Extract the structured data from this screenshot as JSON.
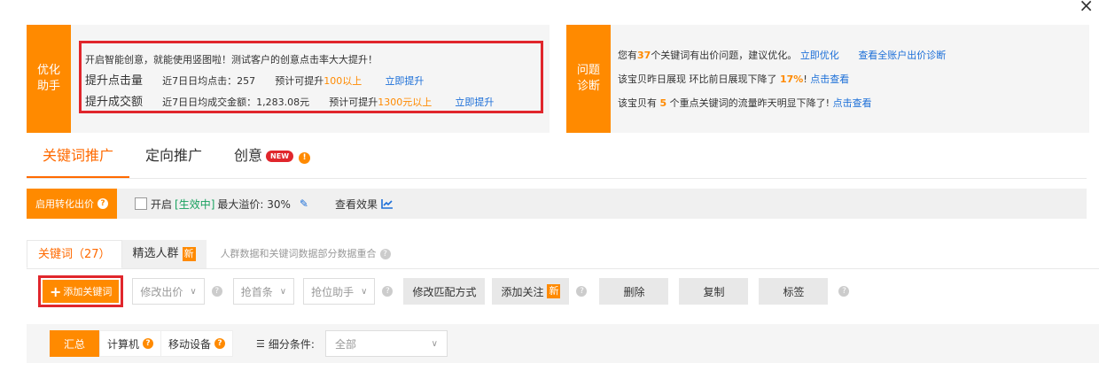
{
  "close": "×",
  "optimize": {
    "tag": "优化助手",
    "line1": "开启智能创意，就能使用竖图啦！测试客户的创意点击率大大提升！",
    "line2": {
      "title": "提升点击量",
      "stat_label": "近7日日均点击：257",
      "predict_prefix": "预计可提升",
      "predict_value": "100以上",
      "action": "立即提升"
    },
    "line3": {
      "title": "提升成交额",
      "stat_label": "近7日日均成交金额：1,283.08元",
      "predict_prefix": "预计可提升",
      "predict_value": "1300元以上",
      "action": "立即提升"
    }
  },
  "diagnosis": {
    "tag": "问题诊断",
    "line1": {
      "prefix": "您有",
      "count": "37",
      "suffix": "个关键词有出价问题，建议优化。",
      "link1": "立即优化",
      "link2": "查看全账户出价诊断"
    },
    "line2": {
      "text": "该宝贝昨日展现 环比前日展现下降了",
      "pct": "17%",
      "bang": "!",
      "link": "点击查看"
    },
    "line3": {
      "prefix": "该宝贝有",
      "count": "5",
      "suffix": "个重点关键词的流量昨天明显下降了!",
      "link": "点击查看"
    }
  },
  "main_tabs": {
    "keyword": "关键词推广",
    "targeting": "定向推广",
    "creative": "创意",
    "new_badge": "NEW",
    "info": "!"
  },
  "conversion": {
    "button": "启用转化出价",
    "q": "?",
    "enable": "开启",
    "status": "[生效中]",
    "premium": "最大溢价: 30%",
    "view_effect": "查看效果"
  },
  "sub_tabs": {
    "keywords": "关键词（27）",
    "audience": "精选人群",
    "xin": "新",
    "note": "人群数据和关键词数据部分数据重合",
    "q": "?"
  },
  "toolbar": {
    "add": "添加关键词",
    "plus": "+",
    "modify_bid": "修改出价",
    "top_slot": "抢首条",
    "rank_assist": "抢位助手",
    "modify_match": "修改匹配方式",
    "add_follow": "添加关注",
    "xin": "新",
    "delete": "删除",
    "copy": "复制",
    "tag": "标签",
    "q": "?",
    "chev": "∨"
  },
  "segments": {
    "summary": "汇总",
    "computer": "计算机",
    "mobile": "移动设备",
    "q": "?",
    "filter_label": "细分条件:",
    "filter_value": "全部",
    "chev": "∨"
  },
  "colors": {
    "accent": "#ff8a00",
    "highlight_border": "#e0262c",
    "link": "#1c6fd8",
    "status_green": "#19a15f"
  }
}
